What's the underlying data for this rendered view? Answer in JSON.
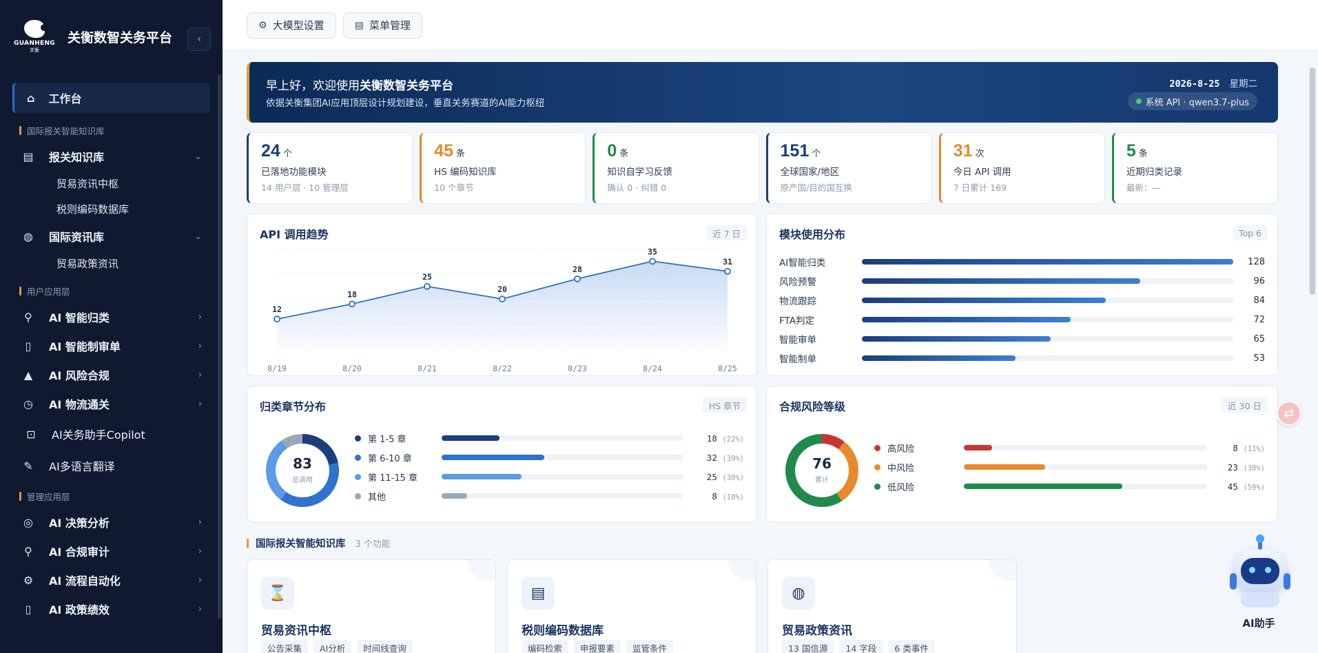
{
  "brand": {
    "title": "关衡数智关务平台",
    "logo_text": "GUANHENG",
    "logo_sub": "关衡"
  },
  "sidebar": {
    "workbench": "工作台",
    "sections": {
      "knowledge": "国际报关智能知识库",
      "user_apps": "用户应用层",
      "mgmt_apps": "管理应用层"
    },
    "items": {
      "customs_kb": "报关知识库",
      "trade_info_hub": "贸易资讯中枢",
      "tariff_db": "税则编码数据库",
      "intl_info_lib": "国际资讯库",
      "trade_policy_info": "贸易政策资讯",
      "ai_classify": "AI 智能归类",
      "ai_docs": "AI 智能制审单",
      "ai_risk": "AI 风险合规",
      "ai_logistics": "AI 物流通关",
      "ai_copilot": "AI关务助手Copilot",
      "ai_translate": "AI多语言翻译",
      "ai_decision": "AI 决策分析",
      "ai_audit": "AI 合规审计",
      "ai_rpa": "AI 流程自动化",
      "ai_policy": "AI 政策绩效"
    }
  },
  "topbar": {
    "llm_settings": "大模型设置",
    "menu_mgmt": "菜单管理"
  },
  "banner": {
    "greeting_prefix": "早上好，欢迎使用",
    "greeting_name": "关衡数智关务平台",
    "description": "依据关衡集团AI应用顶层设计规划建设，垂直关务赛道的AI能力枢纽",
    "date": "2026-8-25",
    "weekday": "星期二",
    "api_status": "系统 API · qwen3.7-plus"
  },
  "stats": [
    {
      "num": "24",
      "unit": "个",
      "label": "已落地功能模块",
      "sub": "14 用户层 · 10 管理层",
      "color": "#1a3e78"
    },
    {
      "num": "45",
      "unit": "条",
      "label": "HS 编码知识库",
      "sub": "10 个章节",
      "color": "#e08a2a"
    },
    {
      "num": "0",
      "unit": "条",
      "label": "知识自学习反馈",
      "sub": "确认 0 · 纠错 0",
      "color": "#1f8a4c"
    },
    {
      "num": "151",
      "unit": "个",
      "label": "全球国家/地区",
      "sub": "原产国/目的国互换",
      "color": "#1a3e78"
    },
    {
      "num": "31",
      "unit": "次",
      "label": "今日 API 调用",
      "sub": "7 日累计 169",
      "color": "#e08a2a"
    },
    {
      "num": "5",
      "unit": "条",
      "label": "近期归类记录",
      "sub": "最新：—",
      "color": "#1f8a4c"
    }
  ],
  "api_trend": {
    "title": "API 调用趋势",
    "tag": "近 7 日"
  },
  "module_usage": {
    "title": "模块使用分布",
    "tag": "Top 6"
  },
  "chapter_dist": {
    "title": "归类章节分布",
    "tag": "HS 章节",
    "center_value": "83",
    "center_label": "总调用"
  },
  "risk_level": {
    "title": "合规风险等级",
    "tag": "近 30 日",
    "center_value": "76",
    "center_label": "累计"
  },
  "chart_data": [
    {
      "type": "line",
      "title": "API 调用趋势",
      "categories": [
        "8/19",
        "8/20",
        "8/21",
        "8/22",
        "8/23",
        "8/24",
        "8/25"
      ],
      "values": [
        12,
        18,
        25,
        20,
        28,
        35,
        31
      ],
      "ylim": [
        0,
        40
      ],
      "grid": true,
      "color": "#2f6fca"
    },
    {
      "type": "bar",
      "title": "模块使用分布",
      "categories": [
        "AI智能归类",
        "风险预警",
        "物流跟踪",
        "FTA判定",
        "智能审单",
        "智能制单"
      ],
      "values": [
        128,
        96,
        84,
        72,
        65,
        53
      ],
      "xlim": [
        0,
        128
      ]
    },
    {
      "type": "pie",
      "title": "归类章节分布",
      "categories": [
        "第 1-5 章",
        "第 6-10 章",
        "第 11-15 章",
        "其他"
      ],
      "values": [
        18,
        32,
        25,
        8
      ],
      "percent_labels": [
        "(22%)",
        "(39%)",
        "(30%)",
        "(10%)"
      ],
      "colors": [
        "#1b3f7d",
        "#2f72cf",
        "#5a9ae6",
        "#9aa7b8"
      ]
    },
    {
      "type": "pie",
      "title": "合规风险等级",
      "categories": [
        "高风险",
        "中风险",
        "低风险"
      ],
      "values": [
        8,
        23,
        45
      ],
      "percent_labels": [
        "(11%)",
        "(30%)",
        "(59%)"
      ],
      "colors": [
        "#c9362f",
        "#e8892c",
        "#1f8a4c"
      ]
    }
  ],
  "feature_section": {
    "title": "国际报关智能知识库",
    "count": "3 个功能"
  },
  "features": [
    {
      "title": "贸易资讯中枢",
      "icon": "hourglass-icon",
      "tags": [
        "公告采集",
        "AI分析",
        "时间线查询"
      ]
    },
    {
      "title": "税则编码数据库",
      "icon": "ledger-icon",
      "tags": [
        "编码检索",
        "申报要素",
        "监管条件"
      ]
    },
    {
      "title": "贸易政策资讯",
      "icon": "globe-icon",
      "tags": [
        "13 国信源",
        "14 字段",
        "6 类事件"
      ]
    }
  ],
  "assistant": {
    "label": "AI助手"
  }
}
